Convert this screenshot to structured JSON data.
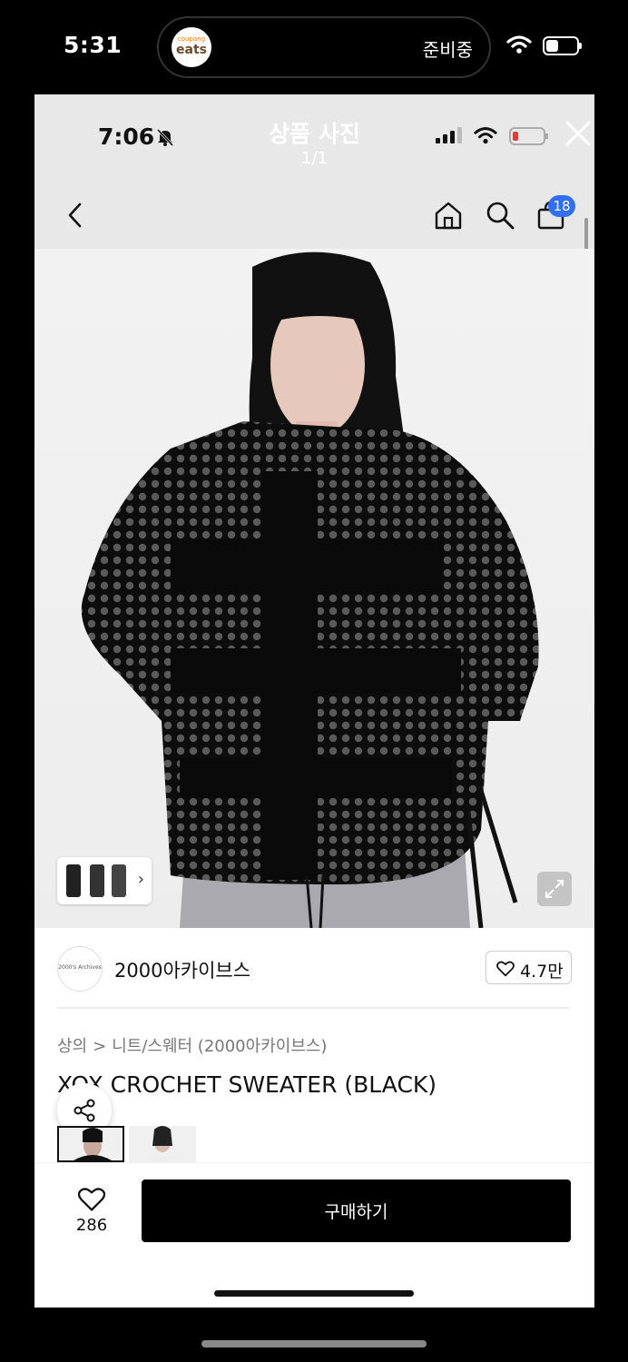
{
  "outer_status": {
    "time": "5:31",
    "island_logo_top": "coupang",
    "island_logo_bottom": "eats",
    "island_status": "준비중"
  },
  "inner_status": {
    "time": "7:06"
  },
  "viewer": {
    "title": "상품 사진",
    "counter": "1/1"
  },
  "header": {
    "cart_count": "18"
  },
  "brand": {
    "logo_text": "2000's Archives",
    "name": "2000아카이브스",
    "likes": "4.7만"
  },
  "breadcrumb": {
    "category": "상의",
    "separator": ">",
    "subcategory": "니트/스웨터 (2000아카이브스)"
  },
  "product": {
    "title": "XOX CROCHET SWEATER (BLACK)"
  },
  "bottom_bar": {
    "wish_count": "286",
    "buy_label": "구매하기"
  },
  "colors": {
    "accent": "#2f6ff0",
    "buy_button": "#000000"
  },
  "icons": [
    "bell-slash-icon",
    "wifi-icon",
    "battery-icon",
    "close-icon",
    "back-icon",
    "home-icon",
    "search-icon",
    "shopping-bag-icon",
    "expand-icon",
    "heart-icon",
    "share-icon",
    "chevron-right-icon"
  ]
}
